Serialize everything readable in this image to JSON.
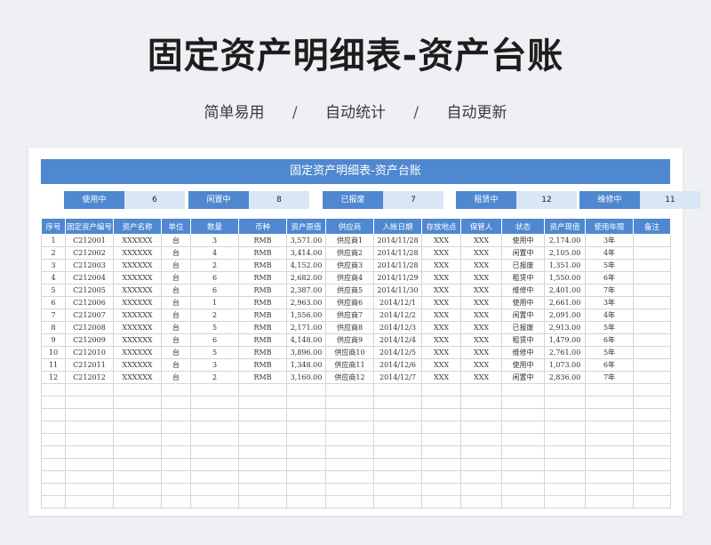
{
  "title": "固定资产明细表-资产台账",
  "subtitle": [
    "简单易用",
    "自动统计",
    "自动更新"
  ],
  "separator": "/",
  "sheet_title": "固定资产明细表-资产台账",
  "stats": [
    {
      "label": "使用中",
      "value": "6"
    },
    {
      "label": "闲置中",
      "value": "8"
    },
    {
      "label": "已报废",
      "value": "7"
    },
    {
      "label": "租赁中",
      "value": "12"
    },
    {
      "label": "维修中",
      "value": "11"
    }
  ],
  "columns": [
    "序号",
    "固定资产编号",
    "资产名称",
    "单位",
    "数量",
    "币种",
    "资产原值",
    "供应商",
    "入帐日期",
    "存放地点",
    "保管人",
    "状态",
    "资产现值",
    "使用年限",
    "备注"
  ],
  "rows": [
    [
      "1",
      "C212001",
      "XXXXXX",
      "台",
      "3",
      "RMB",
      "3,571.00",
      "供应商1",
      "2014/11/28",
      "XXX",
      "XXX",
      "使用中",
      "2,174.00",
      "3年",
      ""
    ],
    [
      "2",
      "C212002",
      "XXXXXX",
      "台",
      "4",
      "RMB",
      "3,414.00",
      "供应商2",
      "2014/11/28",
      "XXX",
      "XXX",
      "闲置中",
      "2,105.00",
      "4年",
      ""
    ],
    [
      "3",
      "C212003",
      "XXXXXX",
      "台",
      "2",
      "RMB",
      "4,152.00",
      "供应商3",
      "2014/11/28",
      "XXX",
      "XXX",
      "已报废",
      "1,351.00",
      "5年",
      ""
    ],
    [
      "4",
      "C212004",
      "XXXXXX",
      "台",
      "6",
      "RMB",
      "2,682.00",
      "供应商4",
      "2014/11/29",
      "XXX",
      "XXX",
      "租赁中",
      "1,550.00",
      "6年",
      ""
    ],
    [
      "5",
      "C212005",
      "XXXXXX",
      "台",
      "6",
      "RMB",
      "2,387.00",
      "供应商5",
      "2014/11/30",
      "XXX",
      "XXX",
      "维修中",
      "2,401.00",
      "7年",
      ""
    ],
    [
      "6",
      "C212006",
      "XXXXXX",
      "台",
      "1",
      "RMB",
      "2,963.00",
      "供应商6",
      "2014/12/1",
      "XXX",
      "XXX",
      "使用中",
      "2,661.00",
      "3年",
      ""
    ],
    [
      "7",
      "C212007",
      "XXXXXX",
      "台",
      "2",
      "RMB",
      "1,556.00",
      "供应商7",
      "2014/12/2",
      "XXX",
      "XXX",
      "闲置中",
      "2,091.00",
      "4年",
      ""
    ],
    [
      "8",
      "C212008",
      "XXXXXX",
      "台",
      "5",
      "RMB",
      "2,171.00",
      "供应商8",
      "2014/12/3",
      "XXX",
      "XXX",
      "已报废",
      "2,913.00",
      "5年",
      ""
    ],
    [
      "9",
      "C212009",
      "XXXXXX",
      "台",
      "6",
      "RMB",
      "4,148.00",
      "供应商9",
      "2014/12/4",
      "XXX",
      "XXX",
      "租赁中",
      "1,479.00",
      "6年",
      ""
    ],
    [
      "10",
      "C212010",
      "XXXXXX",
      "台",
      "5",
      "RMB",
      "3,896.00",
      "供应商10",
      "2014/12/5",
      "XXX",
      "XXX",
      "维修中",
      "2,761.00",
      "5年",
      ""
    ],
    [
      "11",
      "C212011",
      "XXXXXX",
      "台",
      "3",
      "RMB",
      "1,348.00",
      "供应商11",
      "2014/12/6",
      "XXX",
      "XXX",
      "使用中",
      "1,073.00",
      "6年",
      ""
    ],
    [
      "12",
      "C212012",
      "XXXXXX",
      "台",
      "2",
      "RMB",
      "3,160.00",
      "供应商12",
      "2014/12/7",
      "XXX",
      "XXX",
      "闲置中",
      "2,836.00",
      "7年",
      ""
    ]
  ],
  "empty_rows": 10,
  "colors": {
    "accent": "#4f88d0",
    "value_bg": "#d8e6f6",
    "page_bg": "#eef0f3"
  }
}
